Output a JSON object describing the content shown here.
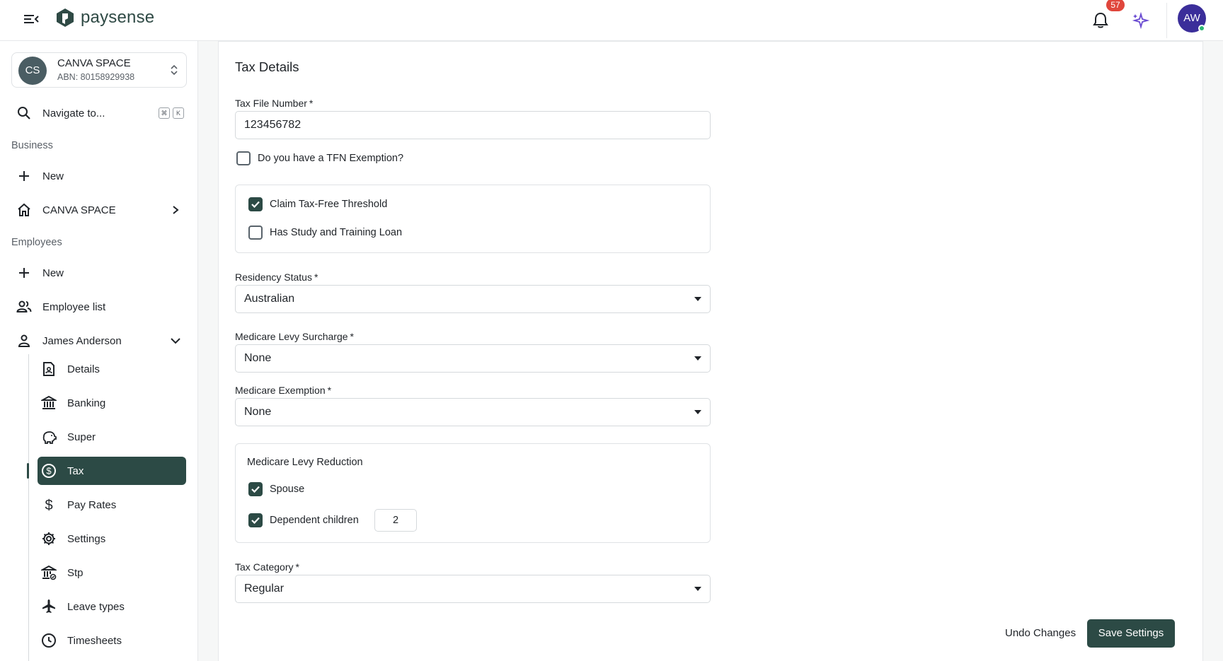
{
  "app": {
    "brand": "paysense",
    "notification_count": "57",
    "user_initials": "AW"
  },
  "org": {
    "initials": "CS",
    "name": "CANVA SPACE",
    "abn": "ABN: 80158929938"
  },
  "sidebar": {
    "search_label": "Navigate to...",
    "kbd": [
      "⌘",
      "K"
    ],
    "business_section": "Business",
    "business_new": "New",
    "business_item": "CANVA SPACE",
    "employees_section": "Employees",
    "employees_new": "New",
    "employee_list": "Employee list",
    "employee_name": "James Anderson",
    "sub_items": [
      "Details",
      "Banking",
      "Super",
      "Tax",
      "Pay Rates",
      "Settings",
      "Stp",
      "Leave types",
      "Timesheets"
    ],
    "active_sub_item": "Tax"
  },
  "form": {
    "title": "Tax Details",
    "tfn_label": "Tax File Number",
    "tfn_value": "123456782",
    "tfn_exemption_label": "Do you have a TFN Exemption?",
    "tfn_exemption_checked": false,
    "claim_threshold_label": "Claim Tax-Free Threshold",
    "claim_threshold_checked": true,
    "study_loan_label": "Has Study and Training Loan",
    "study_loan_checked": false,
    "residency_label": "Residency Status",
    "residency_value": "Australian",
    "mls_label": "Medicare Levy Surcharge",
    "mls_value": "None",
    "medicare_exemption_label": "Medicare Exemption",
    "medicare_exemption_value": "None",
    "mlr_title": "Medicare Levy Reduction",
    "spouse_label": "Spouse",
    "spouse_checked": true,
    "dependent_label": "Dependent children",
    "dependent_checked": true,
    "dependent_count": "2",
    "tax_category_label": "Tax Category",
    "tax_category_value": "Regular",
    "required_mark": "*"
  },
  "actions": {
    "undo_label": "Undo Changes",
    "save_label": "Save Settings"
  },
  "colors": {
    "primary": "#2c4a45",
    "badge": "#e0463c",
    "avatar": "#3b2e9a",
    "sparkle": "#6a4bd1"
  }
}
